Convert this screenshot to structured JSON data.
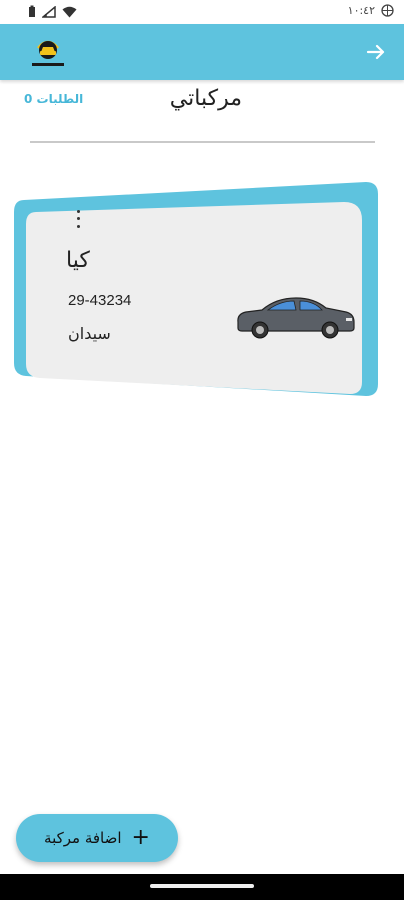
{
  "status_bar": {
    "time": "١٠:٤٢",
    "icons": [
      "battery-icon",
      "signal-icon",
      "wifi-icon",
      "vpn-icon"
    ]
  },
  "app_bar": {
    "logo": "app-logo",
    "back_icon": "arrow-right-icon"
  },
  "header": {
    "title": "مركباتي",
    "orders_count": "الطلبات 0"
  },
  "vehicles": [
    {
      "name": "كيا",
      "plate": "29-43234",
      "type": "سيدان",
      "menu_icon": "more-vert-icon",
      "image": "sedan-car-icon"
    }
  ],
  "fab": {
    "label": "اضافة مركبة",
    "icon": "plus-icon"
  },
  "colors": {
    "primary": "#5ec3de",
    "card_bg": "#eeeeee",
    "accent_text": "#47b7d8"
  }
}
